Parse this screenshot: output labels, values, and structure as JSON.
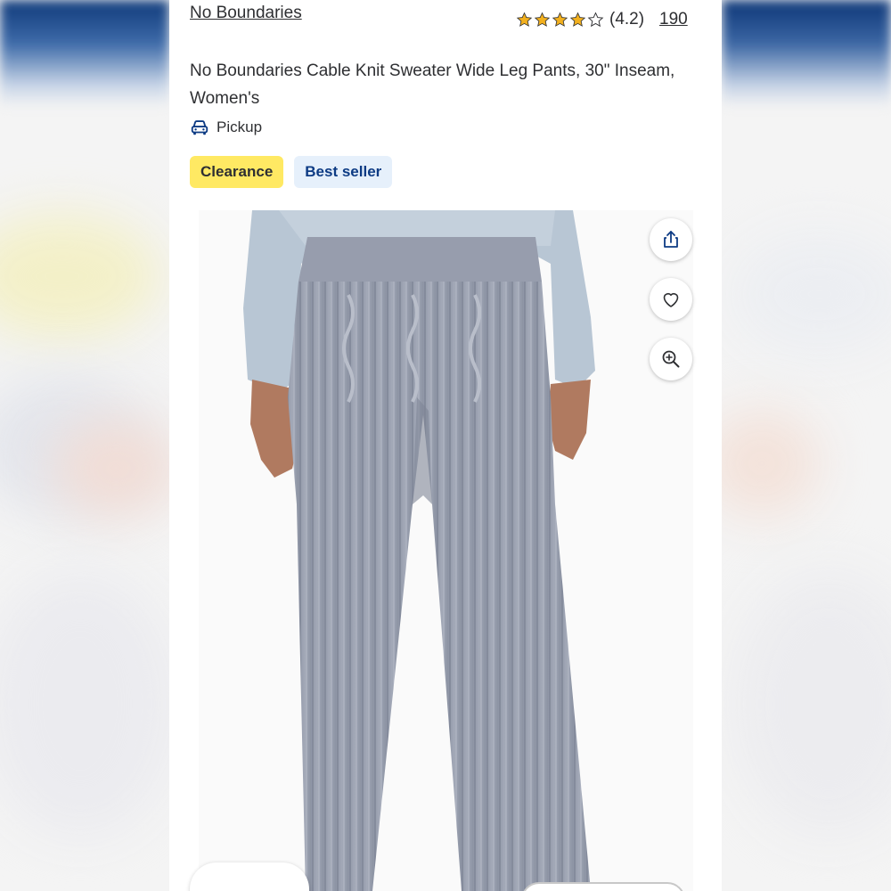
{
  "product": {
    "brand": "No Boundaries",
    "title": "No Boundaries Cable Knit Sweater Wide Leg Pants, 30\" Inseam, Women's",
    "rating": {
      "stars": 4.2,
      "max": 5,
      "value_label": "(4.2)",
      "review_count": "190"
    },
    "fulfillment": {
      "icon": "car-icon",
      "label": "Pickup"
    },
    "badges": [
      {
        "label": "Clearance",
        "color": "#ffe963"
      },
      {
        "label": "Best seller",
        "color": "#e6f0fb"
      }
    ]
  },
  "actions": {
    "share_icon": "share-icon",
    "favorite_icon": "heart-icon",
    "zoom_icon": "zoom-in-icon"
  },
  "colors": {
    "accent_blue": "#0d3b84",
    "star_gold": "#f2b01e",
    "text": "#2e2f32"
  }
}
